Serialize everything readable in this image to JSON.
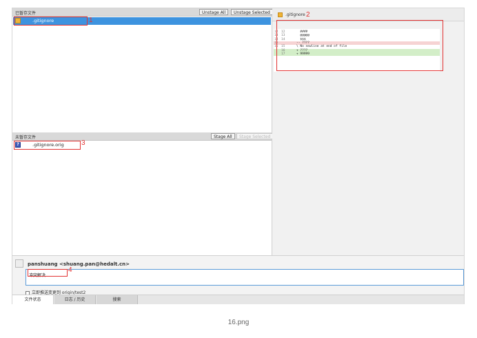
{
  "staged": {
    "title": "已暂存文件",
    "unstage_all": "Unstage All",
    "unstage_selected": "Unstage Selected",
    "files": [
      {
        "name": ".gitignore",
        "status": "modified"
      }
    ]
  },
  "unstaged": {
    "title": "未暂存文件",
    "stage_all": "Stage All",
    "stage_selected": "Stage Selected",
    "files": [
      {
        "name": ".gitignore.orig",
        "status": "unknown"
      }
    ]
  },
  "diff": {
    "filename": ".gitignore",
    "lines": [
      {
        "old": "12",
        "new": "12",
        "type": "ctx",
        "text": "  ####"
      },
      {
        "old": "13",
        "new": "13",
        "type": "ctx",
        "text": "  @@@@@"
      },
      {
        "old": "14",
        "new": "14",
        "type": "ctx",
        "text": "  $$$"
      },
      {
        "old": "15",
        "new": "",
        "type": "del",
        "text": "-- ????"
      },
      {
        "old": "16",
        "new": "15",
        "type": "ctx",
        "text": "\\ No newline at end of file"
      },
      {
        "old": "",
        "new": "16",
        "type": "add",
        "text": "+ ????"
      },
      {
        "old": "",
        "new": "17",
        "type": "add",
        "text": "+ 99999"
      }
    ]
  },
  "annotations": [
    "1",
    "2",
    "3",
    "4"
  ],
  "commit": {
    "author": "panshuang <shuang.pan@hedalt.cn>",
    "message": "冲突解决",
    "push_label": "立即推送变更到 origin/test2"
  },
  "bottom_tabs": [
    "文件状态",
    "日志 / 历史",
    "搜索"
  ],
  "caption": "16.png",
  "colors": {
    "selection": "#3d93df",
    "annotation_red": "#e23232",
    "diff_add": "#d3eec8",
    "diff_del": "#f6d3d3"
  }
}
